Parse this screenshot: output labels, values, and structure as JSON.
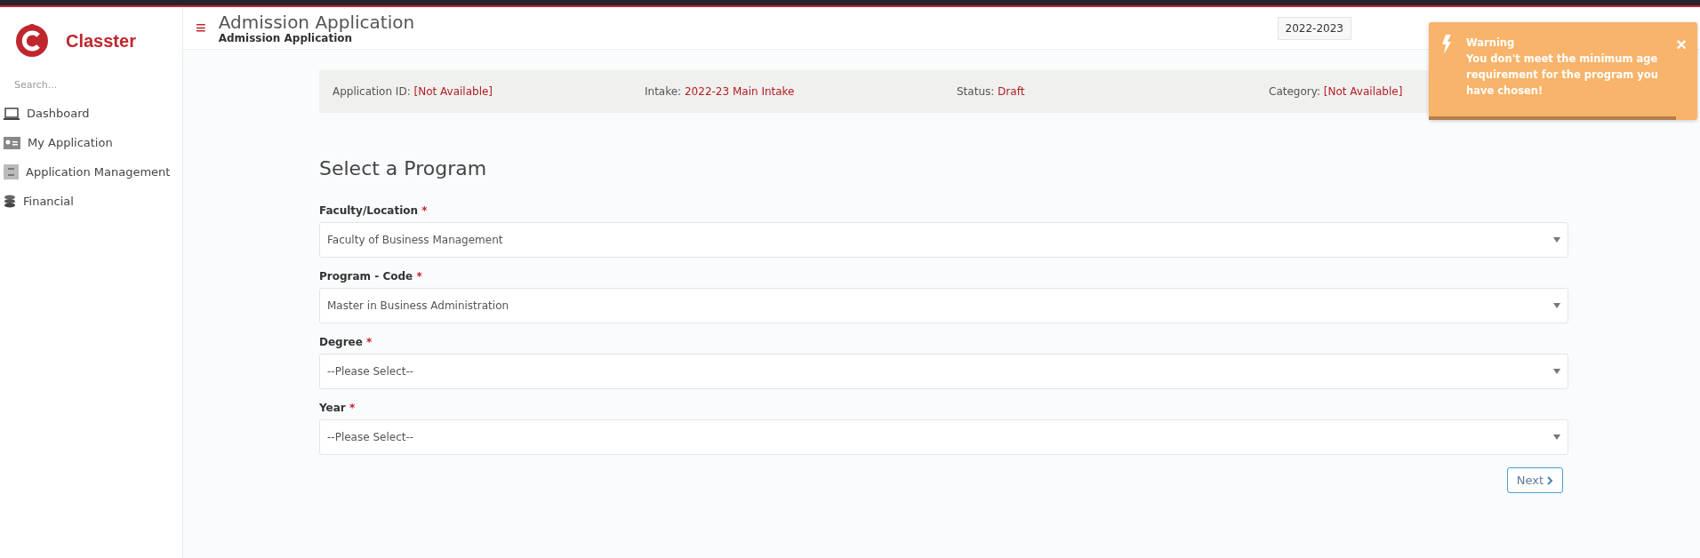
{
  "sidebar": {
    "brand": "Classter",
    "search": {
      "placeholder": "Search..."
    },
    "items": [
      {
        "label": "Dashboard",
        "kind": "laptop"
      },
      {
        "label": "My Application",
        "kind": "card"
      },
      {
        "label": "Application Management",
        "kind": "cabinet"
      },
      {
        "label": "Financial",
        "kind": "coins"
      }
    ]
  },
  "header": {
    "menu_icon": "≡",
    "title": "Admission Application",
    "subtitle": "Admission Application",
    "year": "2022-2023"
  },
  "info_bar": [
    {
      "label": "Application ID:",
      "value": "[Not Available]"
    },
    {
      "label": "Intake:",
      "value": "2022-23 Main Intake"
    },
    {
      "label": "Status:",
      "value": "Draft"
    },
    {
      "label": "Category:",
      "value": "[Not Available]"
    }
  ],
  "form": {
    "title": "Select a Program",
    "fields": [
      {
        "label": "Faculty/Location",
        "required_mark": "*",
        "value": "Faculty of Business Management"
      },
      {
        "label": "Program - Code",
        "required_mark": "*",
        "value": "Master in Business Administration"
      },
      {
        "label": "Degree",
        "required_mark": "*",
        "value": "--Please Select--"
      },
      {
        "label": "Year",
        "required_mark": "*",
        "value": "--Please Select--"
      }
    ],
    "next_button": "Next"
  },
  "toast": {
    "title": "Warning",
    "message": "You don't meet the minimum age requirement for the program you have chosen!",
    "close": "×",
    "level": 0.92
  }
}
